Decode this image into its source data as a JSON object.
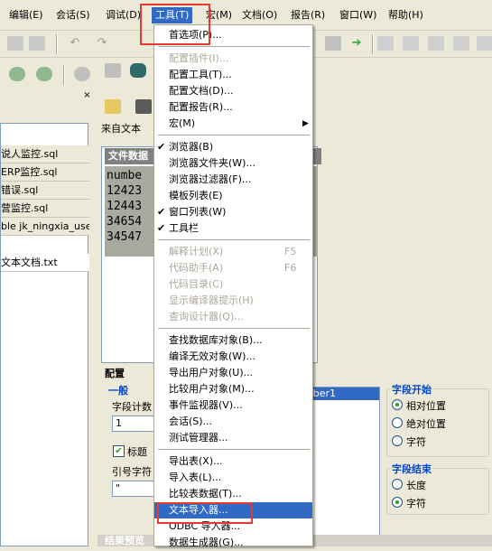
{
  "menubar": {
    "items": [
      "编辑(E)",
      "会话(S)",
      "调试(D)",
      "工具(T)",
      "宏(M)",
      "文档(O)",
      "报告(R)",
      "窗口(W)",
      "帮助(H)"
    ],
    "active_index": 3
  },
  "left_panel": {
    "close_glyph": "×",
    "files": [
      "说人监控.sql",
      "ERP监控.sql",
      "错误.sql",
      "营监控.sql",
      "ble jk_ningxia_user(i",
      "文本文档.txt"
    ],
    "selected_index": 5
  },
  "document": {
    "title": "来自文本",
    "data_header": "文件数据",
    "data_lines": [
      "numbe",
      "12423",
      "12443",
      "34654",
      "34547"
    ]
  },
  "config": {
    "title": "配置",
    "general_label": "一般",
    "field_count_label": "字段计数",
    "field_count_value": "1",
    "title_checkbox_label": "标题",
    "quote_char_label": "引号字符",
    "quote_char_value": "\"",
    "field_list_selected": "mber1",
    "field_start_title": "字段开始",
    "field_start_options": [
      "相对位置",
      "绝对位置",
      "字符"
    ],
    "field_start_selected": 0,
    "field_end_title": "字段结束",
    "field_end_options": [
      "长度",
      "字符"
    ],
    "field_end_selected": 1
  },
  "result_title": "结果预览",
  "tools_menu": {
    "groups": [
      [
        {
          "label": "首选项(P)...",
          "enabled": true
        }
      ],
      [
        {
          "label": "配置插件(I)...",
          "enabled": false
        },
        {
          "label": "配置工具(T)...",
          "enabled": true
        },
        {
          "label": "配置文档(D)...",
          "enabled": true
        },
        {
          "label": "配置报告(R)...",
          "enabled": true
        },
        {
          "label": "宏(M)",
          "enabled": true,
          "submenu": true
        }
      ],
      [
        {
          "label": "浏览器(B)",
          "enabled": true,
          "checked": true
        },
        {
          "label": "浏览器文件夹(W)...",
          "enabled": true
        },
        {
          "label": "浏览器过滤器(F)...",
          "enabled": true
        },
        {
          "label": "模板列表(E)",
          "enabled": true
        },
        {
          "label": "窗口列表(W)",
          "enabled": true,
          "checked": true
        },
        {
          "label": "工具栏",
          "enabled": true,
          "checked": true
        }
      ],
      [
        {
          "label": "解释计划(X)",
          "enabled": false,
          "shortcut": "F5"
        },
        {
          "label": "代码助手(A)",
          "enabled": false,
          "shortcut": "F6"
        },
        {
          "label": "代码目录(C)",
          "enabled": false
        },
        {
          "label": "显示编译器提示(H)",
          "enabled": false
        },
        {
          "label": "查询设计器(Q)...",
          "enabled": false
        }
      ],
      [
        {
          "label": "查找数据库对象(B)...",
          "enabled": true
        },
        {
          "label": "编译无效对象(W)...",
          "enabled": true
        },
        {
          "label": "导出用户对象(U)...",
          "enabled": true
        },
        {
          "label": "比较用户对象(M)...",
          "enabled": true
        },
        {
          "label": "事件监视器(V)...",
          "enabled": true
        },
        {
          "label": "会话(S)...",
          "enabled": true
        },
        {
          "label": "测试管理器...",
          "enabled": true
        }
      ],
      [
        {
          "label": "导出表(X)...",
          "enabled": true
        },
        {
          "label": "导入表(L)...",
          "enabled": true
        },
        {
          "label": "比较表数据(T)...",
          "enabled": true
        },
        {
          "label": "文本导入器...",
          "enabled": true,
          "highlighted": true
        },
        {
          "label": "ODBC 导入器...",
          "enabled": true
        },
        {
          "label": "数据生成器(G)...",
          "enabled": true
        }
      ]
    ]
  },
  "colors": {
    "highlight": "#316ac5",
    "annotation_red": "#e8392f",
    "disabled_text": "#aca899"
  }
}
